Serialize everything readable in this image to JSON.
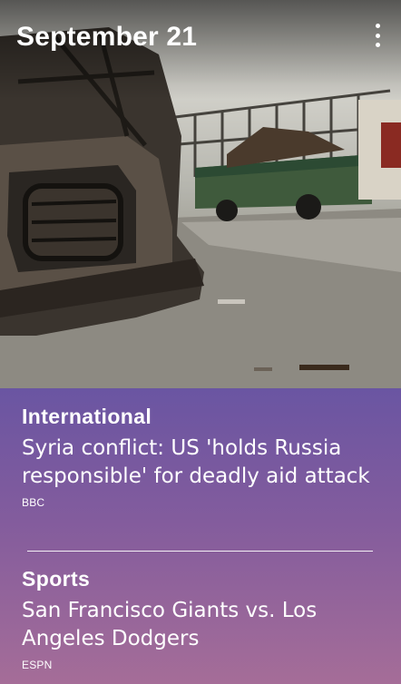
{
  "header": {
    "date": "September 21",
    "menu_icon": "more-vertical-icon"
  },
  "hero": {
    "description_icon": "news-photo"
  },
  "stories": [
    {
      "category": "International",
      "headline": "Syria conflict: US 'holds Russia responsible' for deadly aid attack",
      "source": "BBC"
    },
    {
      "category": "Sports",
      "headline": "San Francisco Giants vs. Los Angeles Dodgers",
      "source": "ESPN"
    }
  ],
  "colors": {
    "panel_top": "#6a55a2",
    "panel_bottom": "#a56d98",
    "text": "#ffffff"
  }
}
